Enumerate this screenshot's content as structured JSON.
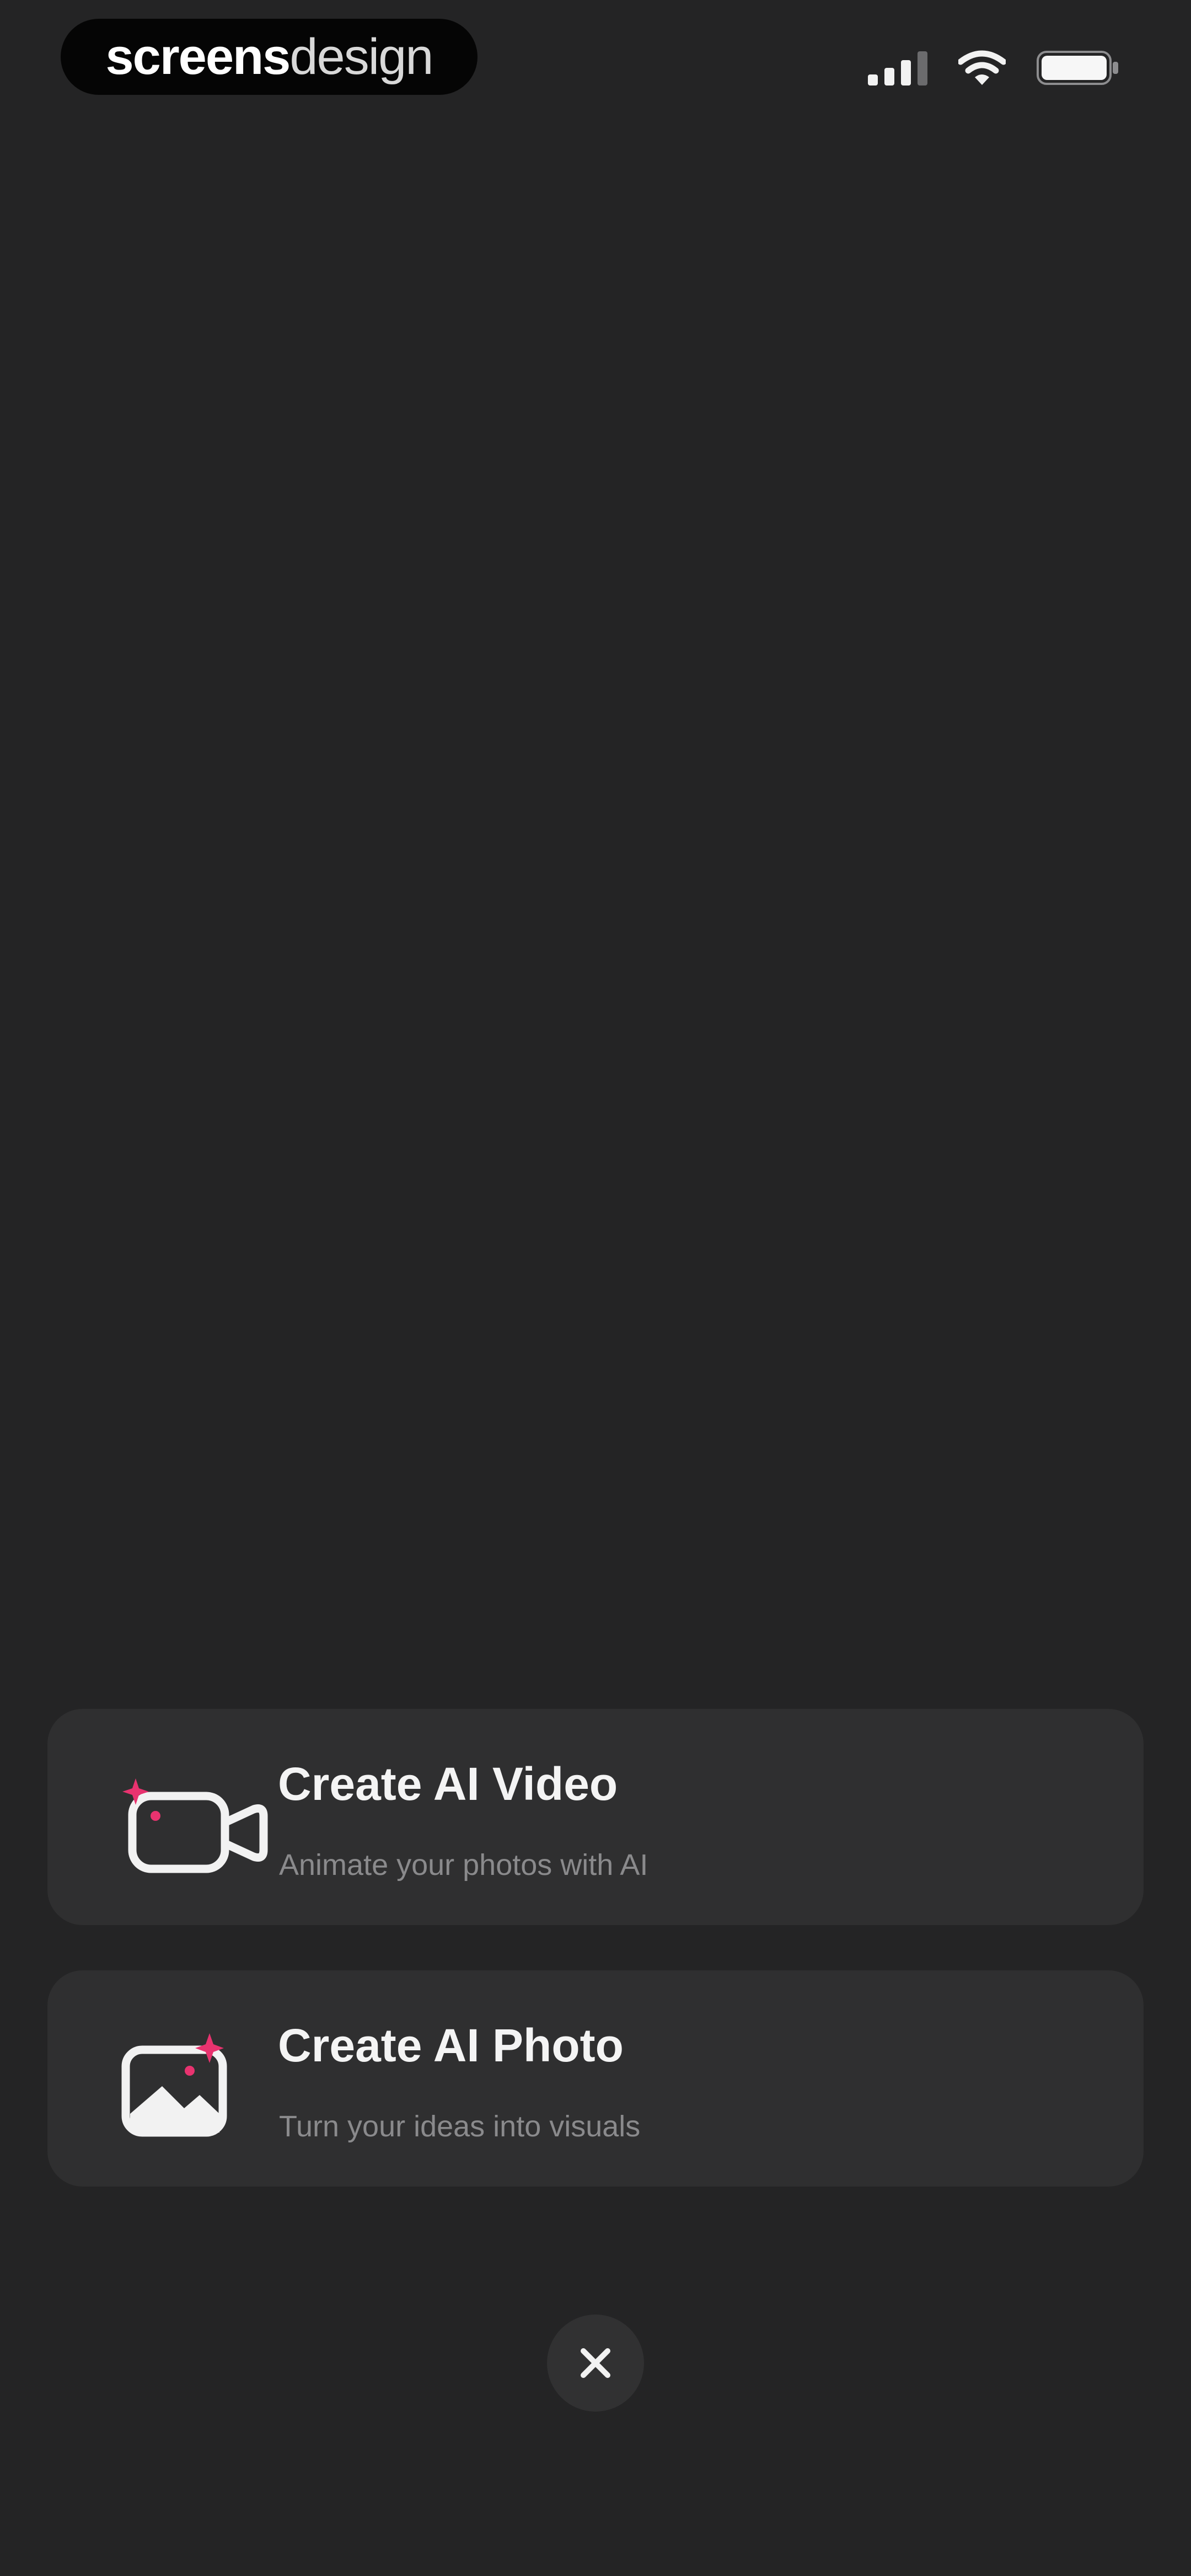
{
  "status_bar": {
    "brand_bold": "screens",
    "brand_light": "design",
    "icons": [
      "cellular-signal-icon",
      "wifi-icon",
      "battery-icon"
    ]
  },
  "actions": [
    {
      "title": "Create AI Video",
      "subtitle": "Animate your photos with AI",
      "icon": "ai-video-camera-icon"
    },
    {
      "title": "Create AI Photo",
      "subtitle": "Turn your ideas into visuals",
      "icon": "ai-photo-image-icon"
    }
  ],
  "close": {
    "icon": "close-icon"
  },
  "colors": {
    "background": "#242425",
    "card": "#2f2f30",
    "accent_sparkle": "#e8336f",
    "title_text": "#f4f4f4",
    "subtitle_text": "#8a8a8c"
  }
}
